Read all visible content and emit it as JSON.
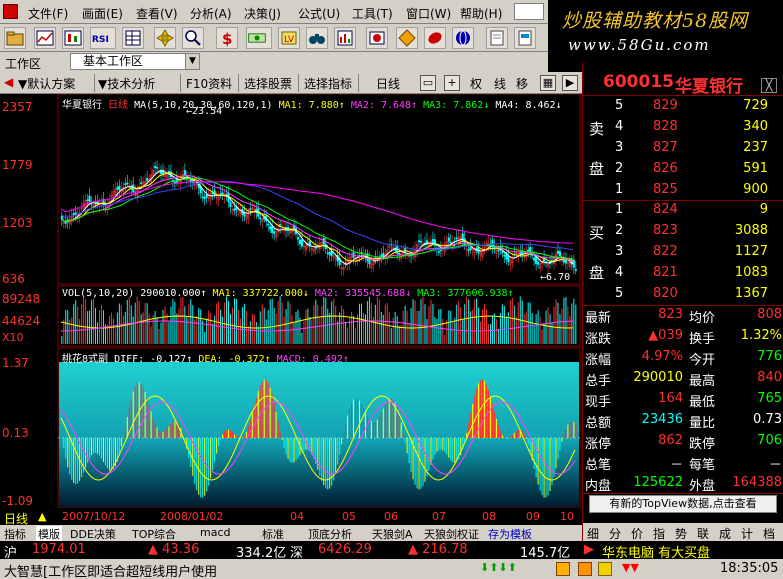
{
  "menu": [
    "文件(F)",
    "画面(E)",
    "查看(V)",
    "分析(A)",
    "决策(J)",
    "公式(U)",
    "工具(T)",
    "窗口(W)",
    "帮助(H)"
  ],
  "banner": {
    "line1": "炒股辅助教材58股网",
    "line2": "www.58Gu.com"
  },
  "workspace": {
    "label": "工作区",
    "value": "基本工作区"
  },
  "tabs": [
    "默认方案",
    "技术分析",
    "F10资料",
    "选择股票",
    "选择指标",
    "日线"
  ],
  "tab_btns": [
    "权",
    "线",
    "移"
  ],
  "price_chart": {
    "stock": "华夏银行",
    "period": "日线",
    "ma_params": "MA(5,10,20,30,60,120,1)",
    "ma1": "MA1: 7.880↑",
    "ma2": "MA2: 7.648↑",
    "ma3": "MA3: 7.862↓",
    "ma4": "MA4: 8.462↓",
    "peak": "23.54",
    "low": "6.70",
    "y_labels": [
      "2357",
      "1779",
      "1203",
      "636"
    ]
  },
  "vol_chart": {
    "params": "VOL(5,10,20)",
    "vol": "290010.000↑",
    "ma1": "MA1: 337722.000↓",
    "ma2": "MA2: 335545.688↓",
    "ma3": "MA3: 377606.938↑",
    "y_labels": [
      "89248",
      "44624",
      "X10"
    ]
  },
  "macd_chart": {
    "name": "桃花8式副",
    "diff": "DIFF: -0.127↑",
    "dea": "DEA: -0.372↑",
    "macd": "MACD: 0.492↑",
    "y_labels": [
      "1.37",
      "0.13",
      "-1.09"
    ]
  },
  "xaxis": {
    "period": "日线",
    "ticks": [
      "2007/10/12",
      "2008/01/02",
      "04",
      "05",
      "06",
      "07",
      "08",
      "09",
      "10"
    ]
  },
  "sheets": [
    "指标",
    "模版",
    "DDE决策",
    "TOP综合",
    "macd",
    "标准",
    "顶底分析",
    "天狼剑A",
    "天狼剑权证",
    "存为模板"
  ],
  "quote": {
    "code": "600015",
    "name": "华夏银行",
    "sell_label": [
      "卖",
      "盘"
    ],
    "buy_label": [
      "买",
      "盘"
    ],
    "sell": [
      {
        "lv": "5",
        "price": "829",
        "vol": "729"
      },
      {
        "lv": "4",
        "price": "828",
        "vol": "340"
      },
      {
        "lv": "3",
        "price": "827",
        "vol": "237"
      },
      {
        "lv": "2",
        "price": "826",
        "vol": "591"
      },
      {
        "lv": "1",
        "price": "825",
        "vol": "900"
      }
    ],
    "buy": [
      {
        "lv": "1",
        "price": "824",
        "vol": "9"
      },
      {
        "lv": "2",
        "price": "823",
        "vol": "3088"
      },
      {
        "lv": "3",
        "price": "822",
        "vol": "1127"
      },
      {
        "lv": "4",
        "price": "821",
        "vol": "1083"
      },
      {
        "lv": "5",
        "price": "820",
        "vol": "1367"
      }
    ],
    "stats": [
      {
        "k1": "最新",
        "v1": "823",
        "c1": "#ff3030",
        "k2": "均价",
        "v2": "808",
        "c2": "#ff3030"
      },
      {
        "k1": "涨跌",
        "v1": "▲039",
        "c1": "#ff3030",
        "k2": "换手",
        "v2": "1.32%",
        "c2": "#ffff00"
      },
      {
        "k1": "涨幅",
        "v1": "4.97%",
        "c1": "#ff3030",
        "k2": "今开",
        "v2": "776",
        "c2": "#00ff00"
      },
      {
        "k1": "总手",
        "v1": "290010",
        "c1": "#ffff00",
        "k2": "最高",
        "v2": "840",
        "c2": "#ff3030"
      },
      {
        "k1": "现手",
        "v1": "164",
        "c1": "#ff3030",
        "k2": "最低",
        "v2": "765",
        "c2": "#00ff00"
      },
      {
        "k1": "总额",
        "v1": "23436",
        "c1": "#00ffff",
        "k2": "量比",
        "v2": "0.73",
        "c2": "#ffffff"
      },
      {
        "k1": "涨停",
        "v1": "862",
        "c1": "#ff3030",
        "k2": "跌停",
        "v2": "706",
        "c2": "#00ff00"
      },
      {
        "k1": "总笔",
        "v1": "－",
        "c1": "#ffffff",
        "k2": "每笔",
        "v2": "－",
        "c2": "#ffffff"
      },
      {
        "k1": "内盘",
        "v1": "125622",
        "c1": "#00ff00",
        "k2": "外盘",
        "v2": "164388",
        "c2": "#ff3030"
      }
    ],
    "topview": "有新的TopView数据,点击查看",
    "tabs": [
      "细",
      "分",
      "价",
      "指",
      "势",
      "联",
      "成",
      "计",
      "档"
    ]
  },
  "ticker": {
    "sh_label": "沪",
    "sh_index": "1974.01",
    "sh_chg": "▲ 43.36",
    "sh_amt": "334.2亿",
    "sz_label": "深",
    "sz_index": "6426.29",
    "sz_chg": "▲ 216.78",
    "sz_amt": "145.7亿",
    "news": "华东电脑 有大买盘"
  },
  "status": {
    "text": "大智慧[工作区即适合超短线用户使用",
    "time": "18:35:05"
  }
}
